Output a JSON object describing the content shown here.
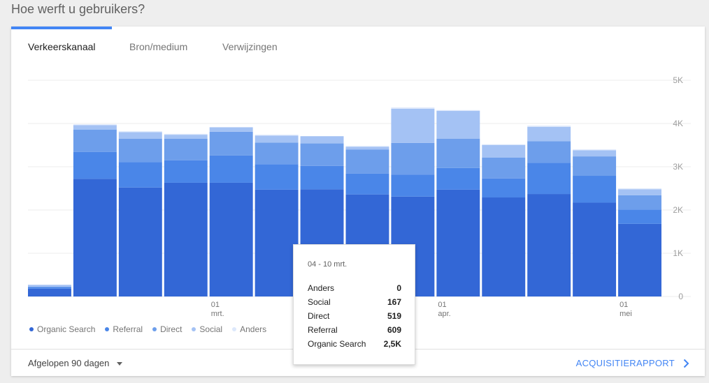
{
  "header": {
    "title": "Hoe werft u gebruikers?"
  },
  "tabs": [
    {
      "label": "Verkeerskanaal",
      "active": true
    },
    {
      "label": "Bron/medium",
      "active": false
    },
    {
      "label": "Verwijzingen",
      "active": false
    }
  ],
  "colors": {
    "organic": "#3367d6",
    "referral": "#4a86e8",
    "direct": "#6d9eeb",
    "social": "#a4c2f4",
    "anders": "#dde8fb",
    "accent": "#4285f4"
  },
  "chart_data": {
    "type": "bar",
    "stacked": true,
    "y_ticks": [
      "0",
      "1K",
      "2K",
      "3K",
      "4K",
      "5K"
    ],
    "ylim": [
      0,
      5000
    ],
    "x_tick_labels": [
      {
        "week": 4,
        "lines": [
          "01",
          "mrt."
        ]
      },
      {
        "week": 9,
        "lines": [
          "01",
          "apr."
        ]
      },
      {
        "week": 13,
        "lines": [
          "01",
          "mei"
        ]
      }
    ],
    "series": [
      {
        "name": "Organic Search",
        "color": "#3367d6",
        "values": [
          180,
          2720,
          2520,
          2630,
          2630,
          2470,
          2480,
          2360,
          2310,
          2470,
          2290,
          2370,
          2170,
          1680
        ]
      },
      {
        "name": "Referral",
        "color": "#4a86e8",
        "values": [
          30,
          620,
          590,
          520,
          630,
          590,
          540,
          480,
          510,
          500,
          440,
          720,
          620,
          330
        ]
      },
      {
        "name": "Direct",
        "color": "#6d9eeb",
        "values": [
          20,
          520,
          540,
          500,
          550,
          500,
          519,
          560,
          730,
          680,
          480,
          500,
          450,
          330
        ]
      },
      {
        "name": "Social",
        "color": "#a4c2f4",
        "values": [
          40,
          100,
          150,
          90,
          100,
          160,
          167,
          60,
          790,
          640,
          290,
          330,
          140,
          140
        ]
      },
      {
        "name": "Anders",
        "color": "#dde8fb",
        "values": [
          0,
          20,
          20,
          20,
          10,
          20,
          0,
          20,
          30,
          20,
          20,
          30,
          20,
          20
        ]
      }
    ]
  },
  "tooltip": {
    "date": "04 - 10 mrt.",
    "rows": [
      {
        "label": "Anders",
        "value": "0"
      },
      {
        "label": "Social",
        "value": "167"
      },
      {
        "label": "Direct",
        "value": "519"
      },
      {
        "label": "Referral",
        "value": "609"
      },
      {
        "label": "Organic Search",
        "value": "2,5K"
      }
    ]
  },
  "footer": {
    "range": "Afgelopen 90 dagen",
    "report_link": "ACQUISITIERAPPORT"
  }
}
